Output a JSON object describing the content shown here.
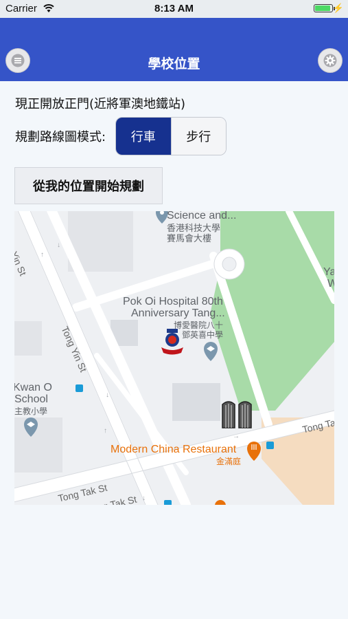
{
  "status_bar": {
    "carrier": "Carrier",
    "time": "8:13 AM",
    "battery_level": 0.9
  },
  "nav": {
    "title": "學校位置",
    "menu_icon": "hamburger-menu-icon",
    "settings_icon": "gear-icon"
  },
  "gate_note": "現正開放正門(近將軍澳地鐵站)",
  "route_mode": {
    "label": "規劃路線圖模式:",
    "options": [
      "行車",
      "步行"
    ],
    "selected": "行車"
  },
  "plan_button": "從我的位置開始規劃",
  "map": {
    "roads": [
      "Tong Yin St",
      "Tong Yin St",
      "Tong Tak St",
      "Tong Tak St",
      "Tong Ta"
    ],
    "places": {
      "science_line1": "Science and...",
      "science_line2": "香港科技大學",
      "science_line3": "賽馬會大樓",
      "school_line1": "Pok Oi Hospital 80th",
      "school_line2": "Anniversary Tang...",
      "school_line3": "博愛醫院八十",
      "school_line4": "鄧英喜中學",
      "kwan_line1": "Kwan O",
      "kwan_line2": "School",
      "kwan_line3": "主教小學",
      "restaurant_line1": "Modern China Restaurant",
      "restaurant_line2": "金滿庭",
      "edge_y": "Ya",
      "edge_w": "W"
    },
    "colors": {
      "park": "#a8dba8",
      "road": "#ffffff",
      "poi": "#7b97ad",
      "restaurant": "#e8710a",
      "transit": "#1a9bd7"
    }
  }
}
